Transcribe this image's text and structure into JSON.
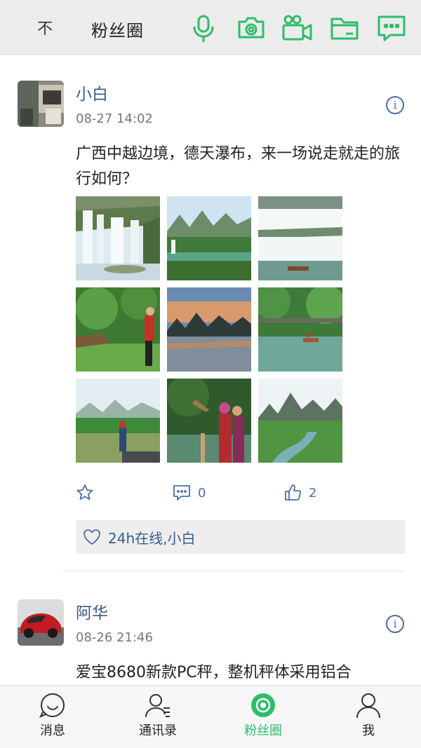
{
  "header": {
    "back_glyph": "不",
    "title": "粉丝圈",
    "icons": [
      "microphone-icon",
      "camera-icon",
      "video-camera-icon",
      "folder-icon",
      "chat-bubble-icon"
    ],
    "accent_color": "#2ebd6b"
  },
  "posts": [
    {
      "author": "小白",
      "time": "08-27 14:02",
      "text": "广西中越边境，德天瀑布，来一场说走就走的旅行如何？",
      "favorite_icon": "star-icon",
      "comment_count": "0",
      "like_count": "2",
      "liked_by": "24h在线,小白",
      "images": [
        "waterfall",
        "karst-river",
        "waterfall-wide",
        "forest-woman",
        "karst-sunset",
        "bamboo-raft",
        "river-woman",
        "costume-women",
        "karst-fields"
      ]
    },
    {
      "author": "阿华",
      "time": "08-26 21:46",
      "text": "爱宝8680新款PC秤，整机秤体采用铝合"
    }
  ],
  "nav": {
    "items": [
      {
        "label": "消息",
        "icon": "chat-face-icon"
      },
      {
        "label": "通讯录",
        "icon": "contacts-icon"
      },
      {
        "label": "粉丝圈",
        "icon": "fan-circle-icon",
        "active": true
      },
      {
        "label": "我",
        "icon": "profile-icon"
      }
    ]
  }
}
